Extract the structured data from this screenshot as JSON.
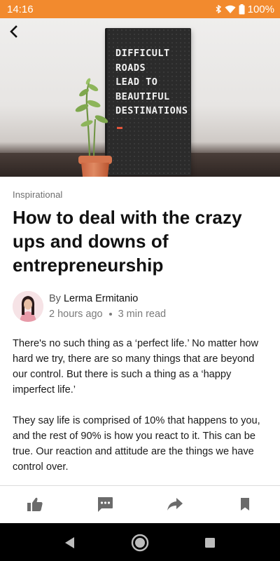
{
  "status_bar": {
    "time": "14:16",
    "battery": "100%"
  },
  "hero": {
    "board_text": "DIFFICULT\nROADS\nLEAD TO\nBEAUTIFUL\nDESTINATIONS"
  },
  "article": {
    "category": "Inspirational",
    "title": "How to deal with the crazy ups and downs of entrepreneurship",
    "by_prefix": "By",
    "author": "Lerma Ermitanio",
    "time_ago": "2 hours ago",
    "read_time": "3 min read",
    "paragraphs": [
      "There's no such thing as a ‘perfect life.’ No matter how hard we try, there are so many things that are beyond our control. But there is such a thing as a ‘happy imperfect life.’",
      "They say life is comprised of 10% that happens to you, and the rest of 90% is how you react to it. This can be true. Our reaction and attitude are the things we have control over."
    ]
  },
  "actions": {
    "like": "thumbs-up-icon",
    "comment": "comment-icon",
    "share": "share-icon",
    "bookmark": "bookmark-icon"
  },
  "colors": {
    "status_bar": "#f28a2e",
    "icon_gray": "#6b6b6b"
  }
}
